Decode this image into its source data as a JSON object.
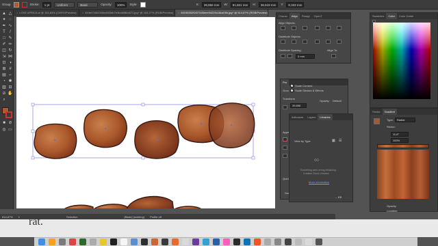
{
  "controlbar": {
    "selection_label": "Group",
    "stroke_label": "Stroke:",
    "stroke_value": "1 pt",
    "profile_value": "Uniform",
    "brush_value": "Basic",
    "opacity_label": "Opacity:",
    "opacity_value": "100%",
    "style_label": "Style:",
    "x_label": "X:",
    "x_value": "39,856 mm",
    "w_label": "W:",
    "w_value": "91,651 mm",
    "h_label": "H:",
    "h_value": "36,619 mm",
    "y_label": "Y:",
    "y_value": "8,333 mm"
  },
  "tabs": [
    {
      "label": "LOVE AFRICA.ai @ 154,83% (CMYK/Preview)",
      "active": false
    },
    {
      "label": "819e07b547b0ed933db7e4bdd98bc672.jpg* @ 163,27% (RGB/Preview)",
      "active": false
    },
    {
      "label": "60196302f1f072cBeee94229c18ca05b.jpg* @ 814,67% (RGB/Preview)",
      "active": true
    }
  ],
  "align_panel": {
    "tabs": [
      "Charac",
      "Align",
      "Paragr",
      "OpenT"
    ],
    "active_tab": "Align",
    "align_objects_label": "Align Objects:",
    "distribute_objects_label": "Distribute Objects:",
    "distribute_spacing_label": "Distribute Spacing:",
    "align_to_label": "Align To:",
    "spacing_value": "0 mm"
  },
  "transform_panel": {
    "tabs": [
      "Pro"
    ],
    "group_label": "Grou",
    "transform_label": "Transform",
    "x_value": "39,856",
    "opacity_label": "Opacity:",
    "opacity_value": "Default",
    "scale_corners_label": "Scale Corners",
    "scale_strokes_label": "Scale Strokes & Effects",
    "appear_label": "Appea",
    "quick_label": "Quick",
    "save_label": "Save"
  },
  "libraries_panel": {
    "tabs": [
      "Artboards",
      "Layers",
      "Libraries"
    ],
    "active_tab": "Libraries",
    "view_by_type": "View by Type",
    "error_line1": "Something went wrong initializing",
    "error_line2": "Creative Cloud Libraries",
    "more_info": "More information",
    "footer_value": "-- KB"
  },
  "color_panel": {
    "tabs": [
      "Swatches",
      "Color",
      "Color Guide"
    ],
    "active_tab": "Color"
  },
  "gradient_panel": {
    "tabs": [
      "Stroke",
      "Gradient"
    ],
    "active_tab": "Gradient",
    "type_label": "Type:",
    "type_value": "Radial",
    "stroke_label": "Stroke:",
    "angle_value": "11,8°",
    "ratio_value": "100%",
    "opacity_label": "Opacity:",
    "location_label": "Location:"
  },
  "status": {
    "zoom": "814,67%",
    "page": "1",
    "tool": "Selection",
    "workspace": "[Basic] (working)",
    "profile": "Profile off"
  },
  "behind_window_text": "rat.",
  "dock": {
    "icon_colors": [
      "#3f8ee8",
      "#f7a21b",
      "#7b7b7b",
      "#d44",
      "#2d6a2d",
      "#aaa",
      "#e9c82e",
      "#1f1f1f",
      "#f5f5f5",
      "#5a8fd6",
      "#2e2e2e",
      "#c63",
      "#3a3a3a",
      "#eb6a2b",
      "#d9d9d9",
      "#6a3d9a",
      "#30a2d5",
      "#2a5fa5",
      "#ff5cbf",
      "#2b2b2b",
      "#0b73b7",
      "#e52",
      "#aaa",
      "#888",
      "#444",
      "#bbb",
      "#d9d9d9",
      "#555"
    ]
  },
  "colors": {
    "bean_fill_light": "#b8693a",
    "bean_fill_dark": "#7a3319",
    "bean_outline": "#3a1a10",
    "selection_blue": "#6b6bd8"
  }
}
